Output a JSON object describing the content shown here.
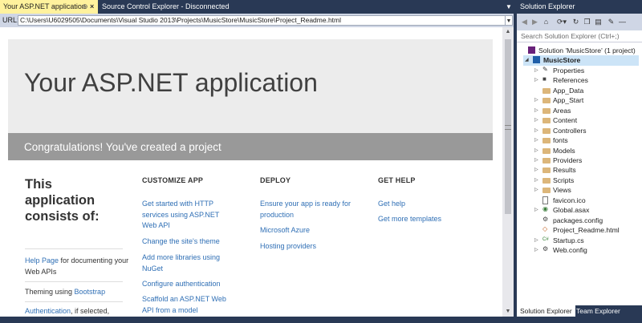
{
  "document_tabs": {
    "active": "Your ASP.NET application",
    "active_pin": "⊕",
    "active_close": "×",
    "inactive": "Source Control Explorer - Disconnected"
  },
  "url_bar": {
    "label": "URL:",
    "value": "C:\\Users\\U6029505\\Documents\\Visual Studio 2013\\Projects\\MusicStore\\MusicStore\\Project_Readme.html"
  },
  "page": {
    "hero_title": "Your ASP.NET application",
    "banner": "Congratulations! You've created a project",
    "intro_title": "This application consists of:",
    "intro_items": [
      {
        "link": "Help Page",
        "text": " for documenting your Web APIs"
      },
      {
        "pre": "Theming using ",
        "link": "Bootstrap"
      },
      {
        "link": "Authentication",
        "text": ", if selected,"
      }
    ],
    "columns": [
      {
        "heading": "CUSTOMIZE APP",
        "links": [
          "Get started with HTTP services using ASP.NET Web API",
          "Change the site's theme",
          "Add more libraries using NuGet",
          "Configure authentication",
          "Scaffold an ASP.NET Web API from a model"
        ]
      },
      {
        "heading": "DEPLOY",
        "links": [
          "Ensure your app is ready for production",
          "Microsoft Azure",
          "Hosting providers"
        ]
      },
      {
        "heading": "GET HELP",
        "links": [
          "Get help",
          "Get more templates"
        ]
      }
    ]
  },
  "solution_explorer": {
    "title": "Solution Explorer",
    "search_placeholder": "Search Solution Explorer (Ctrl+;)",
    "toolbar_icons": [
      "back-icon",
      "forward-icon",
      "home-icon",
      "sync-icon",
      "refresh-icon",
      "collapse-icon",
      "show-all-files-icon",
      "properties-icon",
      "more-icon"
    ],
    "tree": [
      {
        "label": "Solution 'MusicStore' (1 project)",
        "icon": "solution-icon",
        "expander": ""
      },
      {
        "label": "MusicStore",
        "icon": "project-icon",
        "expander": "◢",
        "bold": true,
        "selected": true
      },
      {
        "label": "Properties",
        "icon": "wrench-icon",
        "expander": "▷"
      },
      {
        "label": "References",
        "icon": "references-icon",
        "expander": "▷"
      },
      {
        "label": "App_Data",
        "icon": "folder-icon",
        "expander": ""
      },
      {
        "label": "App_Start",
        "icon": "folder-icon",
        "expander": "▷"
      },
      {
        "label": "Areas",
        "icon": "folder-icon",
        "expander": "▷"
      },
      {
        "label": "Content",
        "icon": "folder-icon",
        "expander": "▷"
      },
      {
        "label": "Controllers",
        "icon": "folder-icon",
        "expander": "▷"
      },
      {
        "label": "fonts",
        "icon": "folder-icon",
        "expander": "▷"
      },
      {
        "label": "Models",
        "icon": "folder-icon",
        "expander": "▷"
      },
      {
        "label": "Providers",
        "icon": "folder-icon",
        "expander": "▷"
      },
      {
        "label": "Results",
        "icon": "folder-icon",
        "expander": "▷"
      },
      {
        "label": "Scripts",
        "icon": "folder-icon",
        "expander": "▷"
      },
      {
        "label": "Views",
        "icon": "folder-icon",
        "expander": "▷"
      },
      {
        "label": "favicon.ico",
        "icon": "file-icon",
        "expander": ""
      },
      {
        "label": "Global.asax",
        "icon": "globe-file-icon",
        "expander": "▷"
      },
      {
        "label": "packages.config",
        "icon": "config-file-icon",
        "expander": ""
      },
      {
        "label": "Project_Readme.html",
        "icon": "html-file-icon",
        "expander": ""
      },
      {
        "label": "Startup.cs",
        "icon": "csharp-file-icon",
        "expander": "▷"
      },
      {
        "label": "Web.config",
        "icon": "config-file-icon",
        "expander": "▷"
      }
    ],
    "bottom_tabs": [
      "Solution Explorer",
      "Team Explorer"
    ]
  },
  "colors": {
    "chrome": "#293955",
    "active_tab": "#fff29d",
    "link": "#2f6fb5",
    "banner": "#999999",
    "hero_bg": "#ececec",
    "selection": "#cce4f7",
    "folder": "#dcb67a"
  }
}
